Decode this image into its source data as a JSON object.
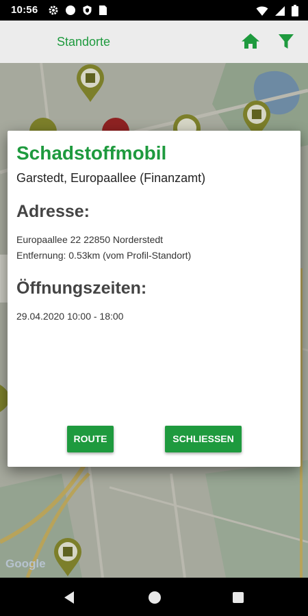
{
  "status_bar": {
    "time": "10:56",
    "left_icons": [
      "gear-icon",
      "circle-icon",
      "shield-icon",
      "sim-icon"
    ],
    "right_icons": [
      "wifi-icon",
      "cell-signal-icon",
      "battery-icon"
    ]
  },
  "app_bar": {
    "title": "Standorte",
    "actions": [
      "home-icon",
      "filter-icon"
    ],
    "accent_color": "#1e9a3e"
  },
  "map": {
    "attribution": "Google",
    "markers": [
      "map-pin-icon",
      "map-pin-icon",
      "map-pin-icon",
      "map-pin-icon",
      "map-pin-icon",
      "map-pin-icon",
      "map-pin-icon",
      "map-pin-icon"
    ]
  },
  "dialog": {
    "title": "Schadstoffmobil",
    "subtitle": "Garstedt, Europaallee (Finanzamt)",
    "address_heading": "Adresse:",
    "address_line": "Europaallee 22 22850 Norderstedt",
    "distance_line": "Entfernung: 0.53km (vom Profil-Standort)",
    "hours_heading": "Öffnungszeiten:",
    "hours_line": "29.04.2020 10:00 - 18:00",
    "route_label": "ROUTE",
    "close_label": "SCHLIESSEN"
  },
  "nav_bar": {
    "buttons": [
      "back-icon",
      "home-button-icon",
      "recents-icon"
    ]
  }
}
